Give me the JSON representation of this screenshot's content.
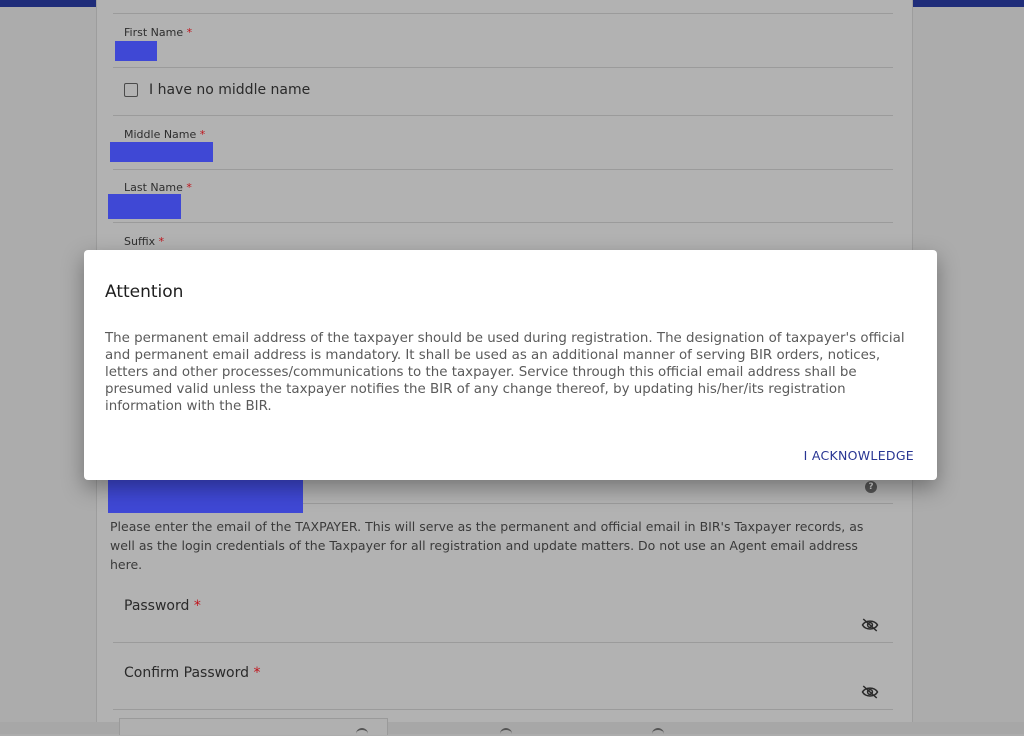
{
  "form": {
    "first_name_label": "First Name",
    "required_mark": "*",
    "no_middle_name_label": "I have no middle name",
    "middle_name_label": "Middle Name",
    "last_name_label": "Last Name",
    "suffix_label": "Suffix",
    "email_help": "Please enter the email of the TAXPAYER. This will serve as the permanent and official email in BIR's Taxpayer records, as well as the login credentials of the Taxpayer for all registration and update matters. Do not use an Agent email address here.",
    "help_icon_glyph": "?",
    "password_label": "Password",
    "confirm_password_label": "Confirm Password"
  },
  "dialog": {
    "title": "Attention",
    "body": "The permanent email address of the taxpayer should be used during registration. The designation of taxpayer's official and permanent email address is mandatory. It shall be used as an additional manner of serving BIR orders, notices, letters and other processes/communications to the taxpayer. Service through this official email address shall be presumed valid unless the taxpayer notifies the BIR of any change thereof, by updating his/her/its registration information with the BIR.",
    "acknowledge_label": "I ACKNOWLEDGE"
  },
  "icons": {
    "checkbox": "checkbox-unchecked",
    "help": "help-circle-icon",
    "password_visibility": "eye-off-icon"
  },
  "colors": {
    "header_bar": "#1f2d7a",
    "required": "#c0131b",
    "redaction": "#3f48d5",
    "dialog_action": "#283593"
  }
}
